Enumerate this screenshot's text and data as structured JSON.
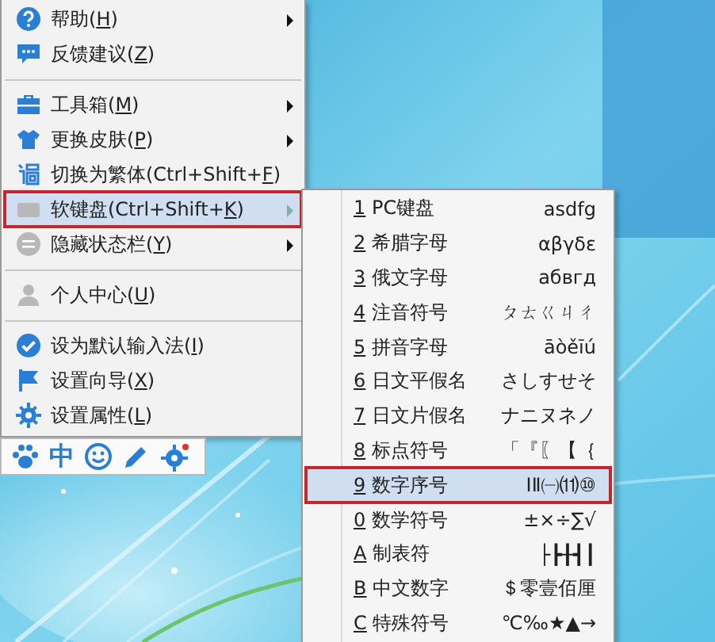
{
  "main_menu": {
    "items": [
      {
        "kind": "item",
        "before": "帮助(",
        "accesskey": "H",
        "after": ")",
        "submenu": true,
        "selected": false
      },
      {
        "kind": "item",
        "before": "反馈建议(",
        "accesskey": "Z",
        "after": ")",
        "submenu": false,
        "selected": false
      },
      {
        "kind": "separator"
      },
      {
        "kind": "item",
        "before": "工具箱(",
        "accesskey": "M",
        "after": ")",
        "submenu": true,
        "selected": false
      },
      {
        "kind": "item",
        "before": "更换皮肤(",
        "accesskey": "P",
        "after": ")",
        "submenu": true,
        "selected": false
      },
      {
        "kind": "item",
        "before": "切换为繁体(Ctrl+Shift+",
        "accesskey": "F",
        "after": ")",
        "submenu": false,
        "selected": false
      },
      {
        "kind": "item",
        "before": "软键盘(Ctrl+Shift+",
        "accesskey": "K",
        "after": ")",
        "submenu": true,
        "selected": true
      },
      {
        "kind": "item",
        "before": "隐藏状态栏(",
        "accesskey": "Y",
        "after": ")",
        "submenu": true,
        "selected": false
      },
      {
        "kind": "separator"
      },
      {
        "kind": "item",
        "before": "个人中心(",
        "accesskey": "U",
        "after": ")",
        "submenu": false,
        "selected": false
      },
      {
        "kind": "separator"
      },
      {
        "kind": "item",
        "before": "设为默认输入法(",
        "accesskey": "I",
        "after": ")",
        "submenu": false,
        "selected": false
      },
      {
        "kind": "item",
        "before": "设置向导(",
        "accesskey": "X",
        "after": ")",
        "submenu": false,
        "selected": false
      },
      {
        "kind": "item",
        "before": "设置属性(",
        "accesskey": "L",
        "after": ")",
        "submenu": false,
        "selected": false
      }
    ]
  },
  "toolbar": {
    "language": "中"
  },
  "soft_keyboard_menu": {
    "items": [
      {
        "key": "1",
        "label": "PC键盘",
        "sample": "asdfg",
        "selected": false
      },
      {
        "key": "2",
        "label": "希腊字母",
        "sample": "αβγδε",
        "selected": false
      },
      {
        "key": "3",
        "label": "俄文字母",
        "sample": "абвгд",
        "selected": false
      },
      {
        "key": "4",
        "label": "注音符号",
        "sample": "ㄆㄊㄍㄐㄔ",
        "selected": false
      },
      {
        "key": "5",
        "label": "拼音字母",
        "sample": "āòěīú",
        "selected": false
      },
      {
        "key": "6",
        "label": "日文平假名",
        "sample": "さしすせそ",
        "selected": false
      },
      {
        "key": "7",
        "label": "日文片假名",
        "sample": "ナニヌネノ",
        "selected": false
      },
      {
        "key": "8",
        "label": "标点符号",
        "sample": "「『〖【｛",
        "selected": false
      },
      {
        "key": "9",
        "label": "数字序号",
        "sample": "ⅠⅡ㈠⑾⑩",
        "selected": true
      },
      {
        "key": "0",
        "label": "数学符号",
        "sample": "±×÷∑√",
        "selected": false
      },
      {
        "key": "A",
        "label": "制表符",
        "sample": "├┣╂┫┃",
        "selected": false
      },
      {
        "key": "B",
        "label": "中文数字",
        "sample": "＄零壹佰厘",
        "selected": false
      },
      {
        "key": "C",
        "label": "特殊符号",
        "sample": "℃‰★▲→",
        "selected": false
      }
    ]
  }
}
